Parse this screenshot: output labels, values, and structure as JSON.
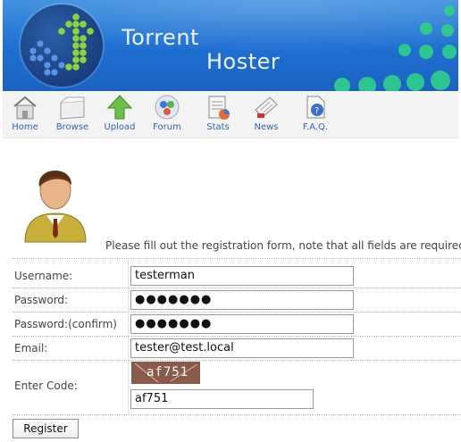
{
  "brand": {
    "line1": "Torrent",
    "line2": "Hoster",
    "logo_icon": "green-arrow-dots-logo-icon"
  },
  "colors": {
    "banner": "#1f6fd0",
    "nav_label": "#2f63b8",
    "logo_green": "#8cd43a"
  },
  "nav": {
    "items": [
      {
        "label": "Home",
        "icon": "home-icon"
      },
      {
        "label": "Browse",
        "icon": "browse-icon"
      },
      {
        "label": "Upload",
        "icon": "upload-icon"
      },
      {
        "label": "Forum",
        "icon": "forum-icon"
      },
      {
        "label": "Stats",
        "icon": "stats-icon"
      },
      {
        "label": "News",
        "icon": "news-icon"
      },
      {
        "label": "F.A.Q.",
        "icon": "faq-icon"
      }
    ]
  },
  "form": {
    "intro": "Please fill out the registration form, note that all fields are required.",
    "username_label": "Username:",
    "username_value": "testerman",
    "password_label": "Password:",
    "password_value": "●●●●●●●",
    "password_confirm_label": "Password:(confirm)",
    "password_confirm_value": "●●●●●●●",
    "email_label": "Email:",
    "email_value": "tester@test.local",
    "code_label": "Enter Code:",
    "captcha_text": "af751",
    "code_value": "af751",
    "register_label": "Register"
  }
}
